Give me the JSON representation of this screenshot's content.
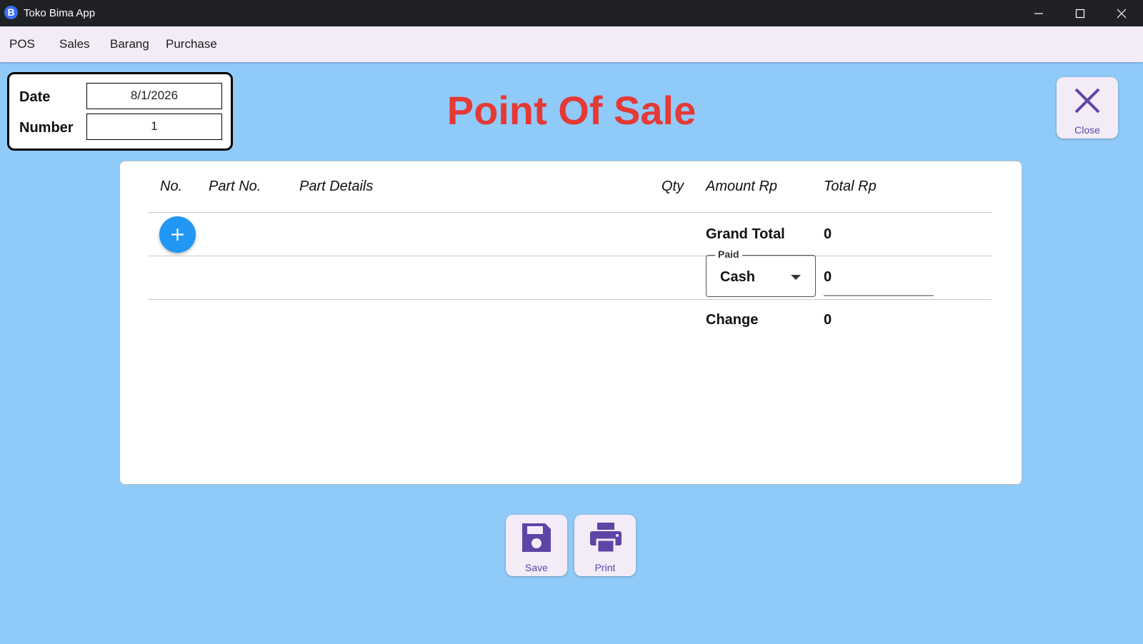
{
  "window": {
    "app_icon_letter": "B",
    "title": "Toko Bima App",
    "controls": [
      "minimize-icon",
      "maximize-icon",
      "close-icon"
    ]
  },
  "menu": {
    "items": [
      {
        "label": "POS"
      },
      {
        "label": "Sales"
      },
      {
        "label": "Barang"
      },
      {
        "label": "Purchase"
      }
    ]
  },
  "info": {
    "date_label": "Date",
    "date_value": "8/1/2026",
    "number_label": "Number",
    "number_value": "1"
  },
  "page_title": "Point Of Sale",
  "close_button": {
    "label": "Close",
    "icon": "x-icon"
  },
  "table": {
    "columns": [
      "No.",
      "Part No.",
      "Part Details",
      "Qty",
      "Amount Rp",
      "Total Rp"
    ],
    "rows": [],
    "add_icon": "plus-icon"
  },
  "summary": {
    "grand_total_label": "Grand Total",
    "grand_total_value": "0",
    "paid_label": "Paid",
    "paid_method": "Cash",
    "paid_amount": "0",
    "change_label": "Change",
    "change_value": "0"
  },
  "actions": {
    "save_label": "Save",
    "print_label": "Print"
  },
  "colors": {
    "background": "#90caf9",
    "title_red": "#e53935",
    "accent_purple": "#5e45a6",
    "add_blue": "#2196f3"
  }
}
